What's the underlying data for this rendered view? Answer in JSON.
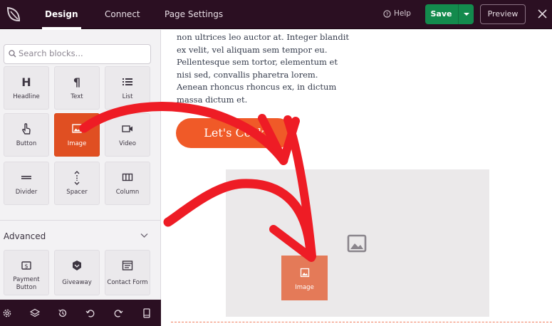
{
  "topbar": {
    "logo_icon": "seedprod-leaf-icon",
    "tabs": [
      {
        "label": "Design",
        "active": true
      },
      {
        "label": "Connect",
        "active": false
      },
      {
        "label": "Page Settings",
        "active": false
      }
    ],
    "help_label": "Help",
    "save_label": "Save",
    "preview_label": "Preview",
    "colors": {
      "bar": "#2b0f22",
      "save": "#138a4d"
    }
  },
  "sidebar": {
    "search_placeholder": "Search blocks...",
    "standard_blocks": [
      {
        "label": "Headline",
        "icon": "headline-icon"
      },
      {
        "label": "Text",
        "icon": "paragraph-icon"
      },
      {
        "label": "List",
        "icon": "list-icon"
      },
      {
        "label": "Button",
        "icon": "pointer-icon"
      },
      {
        "label": "Image",
        "icon": "image-icon",
        "selected": true
      },
      {
        "label": "Video",
        "icon": "video-icon"
      },
      {
        "label": "Divider",
        "icon": "divider-icon"
      },
      {
        "label": "Spacer",
        "icon": "spacer-icon"
      },
      {
        "label": "Column",
        "icon": "column-icon"
      }
    ],
    "advanced_label": "Advanced",
    "advanced_blocks": [
      {
        "label": "Payment Button",
        "icon": "payment-icon"
      },
      {
        "label": "Giveaway",
        "icon": "giveaway-icon"
      },
      {
        "label": "Contact Form",
        "icon": "contact-form-icon"
      }
    ],
    "bottom_icons": [
      "settings-icon",
      "layers-icon",
      "history-icon",
      "undo-icon",
      "redo-icon",
      "device-icon"
    ],
    "accent": "#e04f22"
  },
  "canvas": {
    "paragraph": "non ultrices leo auctor at. Integer blandit\nex velit, vel aliquam sem tempor eu.\nPellentesque sem tortor, elementum et\nnisi sed, convallis pharetra lorem.\nAenean rhoncus rhoncus ex, in dictum\nmassa dictum et.",
    "cta_label": "Let's Cook",
    "dragged_block_label": "Image",
    "cta_color": "#f05a28",
    "arrow_color": "#ee1c25"
  }
}
